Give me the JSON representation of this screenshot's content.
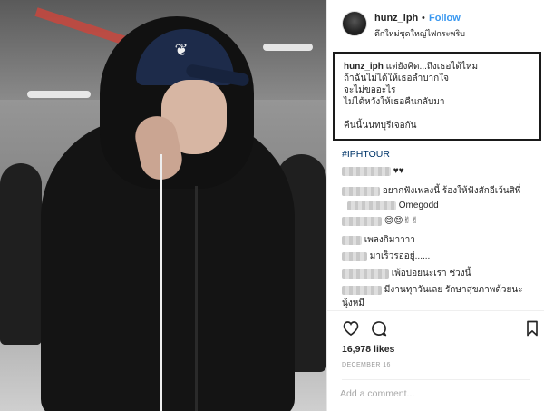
{
  "post": {
    "username": "hunz_iph",
    "separator": "•",
    "follow_label": "Follow",
    "location": "ตึกใหม่ชุดใหญ่ไฟกระพริบ",
    "caption": {
      "username": "hunz_iph",
      "line1": "แต่ยังคิด...ถึงเธอได้ไหม",
      "line2": "ถ้าฉันไม่ได้ให้เธอลำบากใจ",
      "line3": "จะไม่ขออะไร",
      "line4": "ไม่ได้หวังให้เธอคืนกลับมา",
      "line5": "คืนนี้นนทบุรีเจอกัน"
    },
    "hashtag": "#IPHTOUR",
    "comments": [
      {
        "text": "♥♥"
      },
      {
        "text": "อยากฟังเพลงนี้ ร้องให้ฟังสักอีเว้นสิพี่"
      },
      {
        "text": "Omegodd"
      },
      {
        "text": "😊😊✌✌"
      },
      {
        "text": "เพลงกิมาาาา"
      },
      {
        "text": "มาเร็วรออยู่......"
      },
      {
        "text": "เพ้อบ่อยนะเรา ช่วงนี้"
      },
      {
        "text": "มีงานทุกวันเลย รักษาสุขภาพด้วยนะ"
      },
      {
        "text": "นุ้งหมี"
      }
    ],
    "likes": "16,978 likes",
    "date": "DECEMBER 16",
    "comment_placeholder": "Add a comment..."
  },
  "icons": {
    "like": "heart-outline-icon",
    "comment": "speech-bubble-icon",
    "save": "bookmark-icon",
    "logo_on_cap": "bunny-logo"
  },
  "colors": {
    "link_blue": "#3897f0",
    "hashtag": "#003569",
    "muted": "#999999",
    "text": "#262626"
  }
}
